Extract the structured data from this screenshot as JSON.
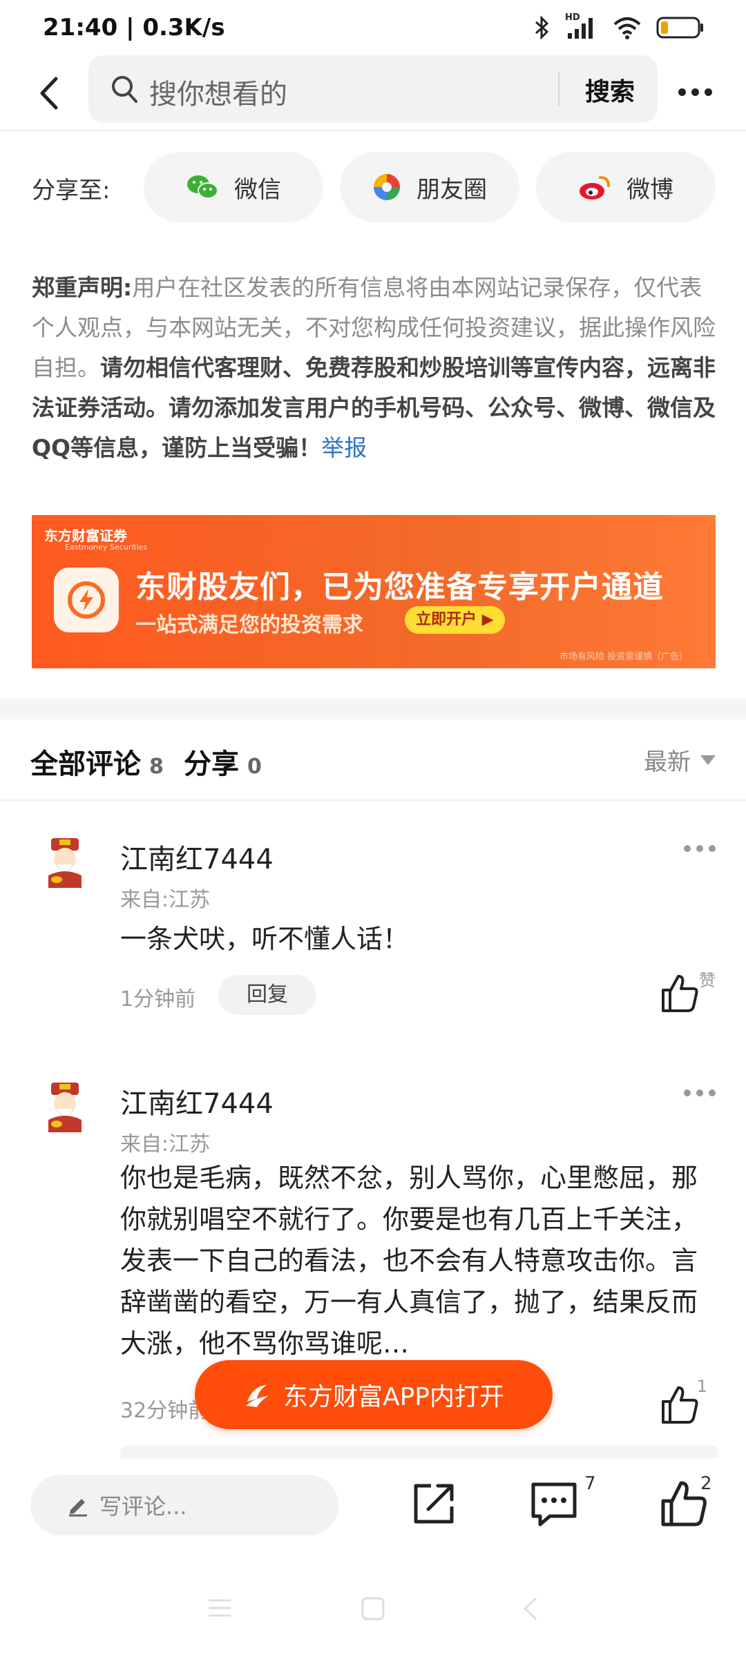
{
  "status_bar": {
    "time": "21:40 | 0.3K/s",
    "network": "HD",
    "icons": [
      "bluetooth-icon",
      "signal-icon",
      "wifi-icon",
      "battery-icon"
    ]
  },
  "nav": {
    "search_placeholder": "搜你想看的",
    "search_button": "搜索"
  },
  "share": {
    "label": "分享至:",
    "targets": [
      {
        "label": "微信",
        "icon": "wechat-icon"
      },
      {
        "label": "朋友圈",
        "icon": "moments-icon"
      },
      {
        "label": "微博",
        "icon": "weibo-icon"
      }
    ]
  },
  "disclaimer": {
    "title": "郑重声明:",
    "text": "用户在社区发表的所有信息将由本网站记录保存，仅代表个人观点，与本网站无关，不对您构成任何投资建议，据此操作风险自担。",
    "warning": "请勿相信代客理财、免费荐股和炒股培训等宣传内容，远离非法证券活动。请勿添加发言用户的手机号码、公众号、微博、微信及QQ等信息，谨防上当受骗！",
    "report": "举报"
  },
  "banner": {
    "brand": "东方财富证券",
    "brand_en": "Eastmoney Securities",
    "headline": "东财股友们，已为您准备专享开户通道",
    "subline": "一站式满足您的投资需求",
    "button": "立即开户 ▶",
    "risk": "市场有风险 投资需谨慎（广告）"
  },
  "comments_header": {
    "all_label": "全部评论",
    "all_count": "8",
    "share_label": "分享",
    "share_count": "0",
    "sort": "最新"
  },
  "comments": [
    {
      "name": "江南红7444",
      "from": "来自:江苏",
      "text": "一条犬吠，听不懂人话！",
      "time": "1分钟前",
      "reply": "回复",
      "like_label": "赞"
    },
    {
      "name": "江南红7444",
      "from": "来自:江苏",
      "text": "你也是毛病，既然不忿，别人骂你，心里憋屈，那你就别唱空不就行了。你要是也有几百上千关注，发表一下自己的看法，也不会有人特意攻击你。言辞凿凿的看空，万一有人真信了，抛了，结果反而大涨，他不骂你骂谁呢…",
      "time": "32分钟前",
      "like_count": "1"
    }
  ],
  "open_app": "东方财富APP内打开",
  "bottom_bar": {
    "write_placeholder": "写评论...",
    "comment_count": "7",
    "like_count": "2"
  },
  "colors": {
    "accent": "#ff4d0c",
    "link": "#2f73c8",
    "banner": "#f26a2a"
  }
}
